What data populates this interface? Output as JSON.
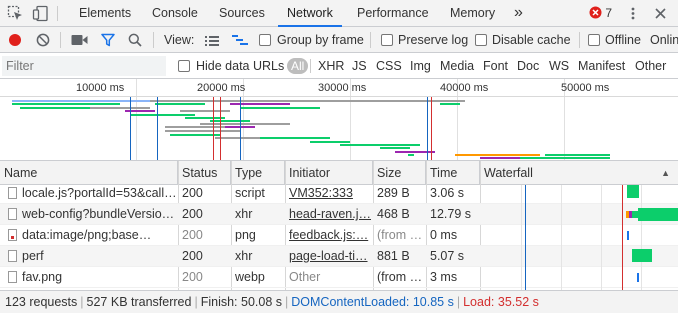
{
  "tabs": [
    {
      "label": "Elements"
    },
    {
      "label": "Console"
    },
    {
      "label": "Sources"
    },
    {
      "label": "Network",
      "active": true
    },
    {
      "label": "Performance"
    },
    {
      "label": "Memory"
    }
  ],
  "more_tabs_label": "»",
  "error_count": "7",
  "toolbar": {
    "view_label": "View:",
    "group_by_frame": "Group by frame",
    "preserve_log": "Preserve log",
    "disable_cache": "Disable cache",
    "offline": "Offline",
    "online": "Online"
  },
  "filter": {
    "placeholder": "Filter",
    "hide_data_urls": "Hide data URLs",
    "types": [
      "All",
      "XHR",
      "JS",
      "CSS",
      "Img",
      "Media",
      "Font",
      "Doc",
      "WS",
      "Manifest",
      "Other"
    ]
  },
  "overview": {
    "ticks": [
      "10000 ms",
      "20000 ms",
      "30000 ms",
      "40000 ms",
      "50000 ms"
    ]
  },
  "table": {
    "headers": {
      "name": "Name",
      "status": "Status",
      "type": "Type",
      "initiator": "Initiator",
      "size": "Size",
      "time": "Time",
      "waterfall": "Waterfall"
    },
    "sort_indicator": "▲",
    "rows": [
      {
        "name": "locale.js?portalId=53&call…",
        "status": "200",
        "type": "script",
        "initiator": "VM352:333",
        "size": "289 B",
        "time": "3.06 s",
        "icon": "file"
      },
      {
        "name": "web-config?bundleVersio…",
        "status": "200",
        "type": "xhr",
        "initiator": "head-raven.j…",
        "size": "468 B",
        "time": "12.79 s",
        "icon": "file"
      },
      {
        "name": "data:image/png;base…",
        "status": "200",
        "type": "png",
        "initiator": "feedback.js:…",
        "size": "(from …",
        "time": "0 ms",
        "icon": "image"
      },
      {
        "name": "perf",
        "status": "200",
        "type": "xhr",
        "initiator": "page-load-ti…",
        "size": "881 B",
        "time": "5.07 s",
        "icon": "file"
      },
      {
        "name": "fav.png",
        "status": "200",
        "type": "webp",
        "initiator": "Other",
        "size": "(from …",
        "time": "3 ms",
        "icon": "file"
      }
    ]
  },
  "status": {
    "requests": "123 requests",
    "transferred": "527 KB transferred",
    "finish": "Finish: 50.08 s",
    "dom_content_loaded": "DOMContentLoaded: 10.85 s",
    "load": "Load: 35.52 s"
  },
  "colors": {
    "accent": "#1a73e8",
    "record": "#e0201b",
    "dom_line": "#1565c0",
    "load_line": "#d32f2f",
    "bar_green": "#0cce6b",
    "bar_purple": "#9c27b0",
    "bar_orange": "#ff9800"
  }
}
